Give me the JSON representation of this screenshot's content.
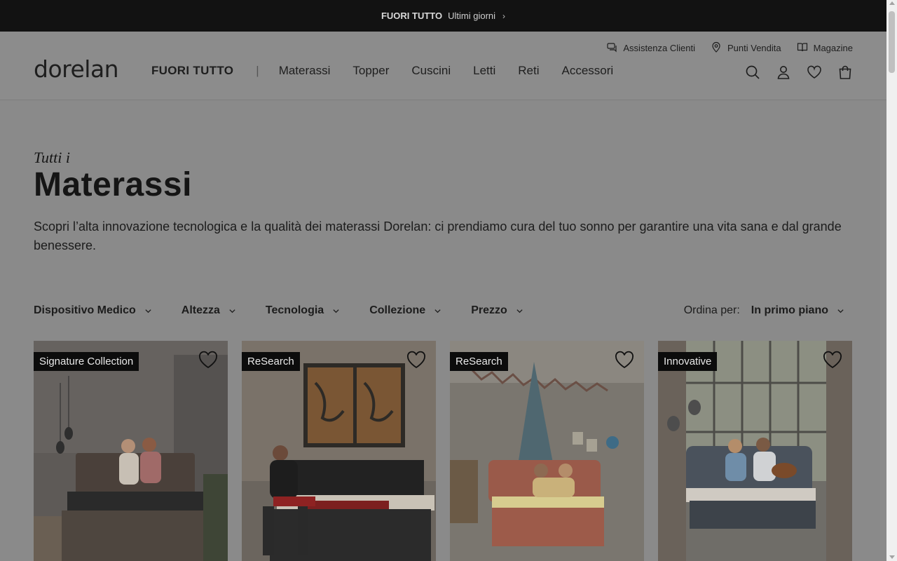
{
  "promo_bar": {
    "strong": "FUORI TUTTO",
    "text": "Ultimi giorni",
    "chevron_icon": "chevron-right"
  },
  "utility_links": [
    {
      "label": "Assistenza Clienti",
      "icon": "chat-icon"
    },
    {
      "label": "Punti Vendita",
      "icon": "location-pin-icon"
    },
    {
      "label": "Magazine",
      "icon": "book-icon"
    }
  ],
  "logo": "dorelan",
  "nav": {
    "promo": "FUORI TUTTO",
    "separator": "|",
    "items": [
      "Materassi",
      "Topper",
      "Cuscini",
      "Letti",
      "Reti",
      "Accessori"
    ]
  },
  "header_icons": [
    "search-icon",
    "user-icon",
    "heart-icon",
    "bag-icon"
  ],
  "page": {
    "subtitle": "Tutti i",
    "title": "Materassi",
    "description": "Scopri l’alta innovazione tecnologica e la qualità dei materassi Dorelan: ci prendiamo cura del tuo sonno per garantire una vita sana e dal grande benessere."
  },
  "filters": [
    "Dispositivo Medico",
    "Altezza",
    "Tecnologia",
    "Collezione",
    "Prezzo"
  ],
  "sort": {
    "label": "Ordina per:",
    "value": "In primo piano"
  },
  "products": [
    {
      "badge": "Signature Collection"
    },
    {
      "badge": "ReSearch"
    },
    {
      "badge": "ReSearch"
    },
    {
      "badge": "Innovative"
    }
  ],
  "colors": {
    "overlay_bg": "#8a8a8a",
    "promo_bg": "#121212",
    "badge_bg": "#0c0c0c"
  }
}
